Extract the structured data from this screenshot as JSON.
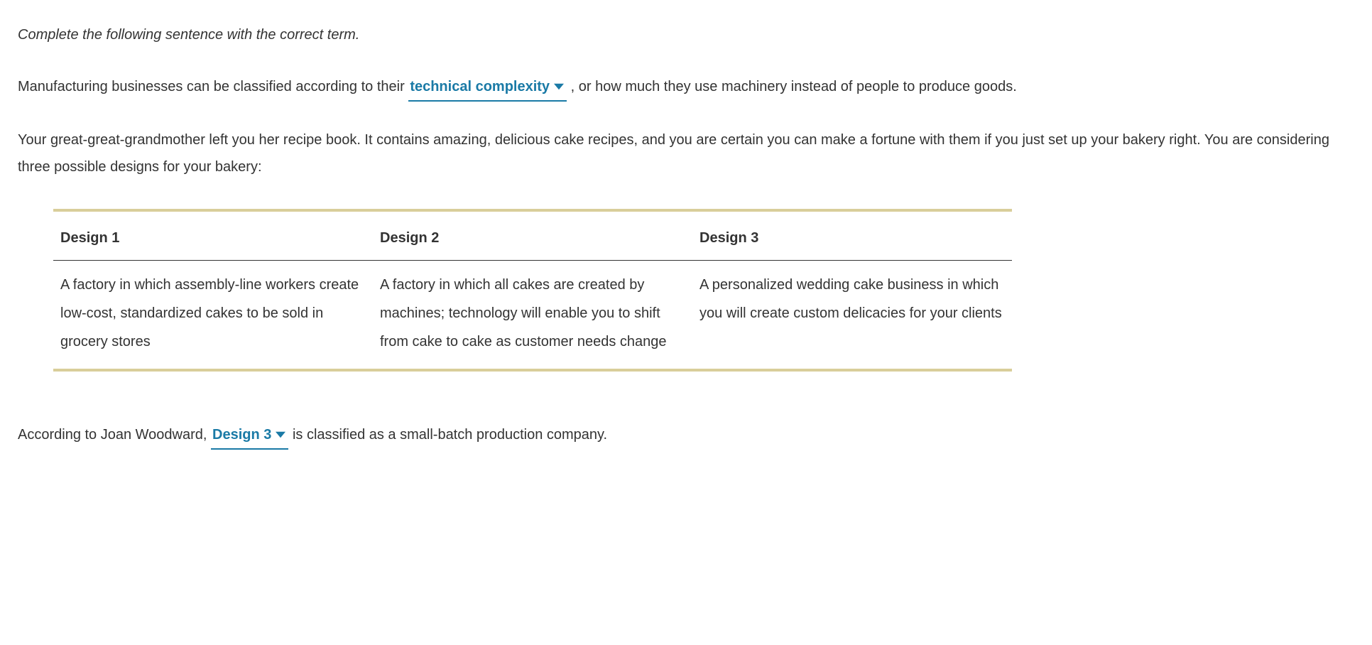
{
  "instruction": "Complete the following sentence with the correct term.",
  "sentence1": {
    "before": "Manufacturing businesses can be classified according to their ",
    "dropdown": "technical complexity",
    "after": " , or how much they use machinery instead of people to produce goods."
  },
  "scenario": "Your great-great-grandmother left you her recipe book. It contains amazing, delicious cake recipes, and you are certain you can make a fortune with them if you just set up your bakery right. You are considering three possible designs for your bakery:",
  "table": {
    "headers": [
      "Design 1",
      "Design 2",
      "Design 3"
    ],
    "cells": [
      "A factory in which assembly-line workers create low-cost, standardized cakes to be sold in grocery stores",
      "A factory in which all cakes are created by machines; technology will enable you to shift from cake to cake as customer needs change",
      "A personalized wedding cake business in which you will create custom delicacies for your clients"
    ]
  },
  "sentence2": {
    "before": "According to Joan Woodward, ",
    "dropdown": "Design 3",
    "after": " is classified as a small-batch production company."
  }
}
